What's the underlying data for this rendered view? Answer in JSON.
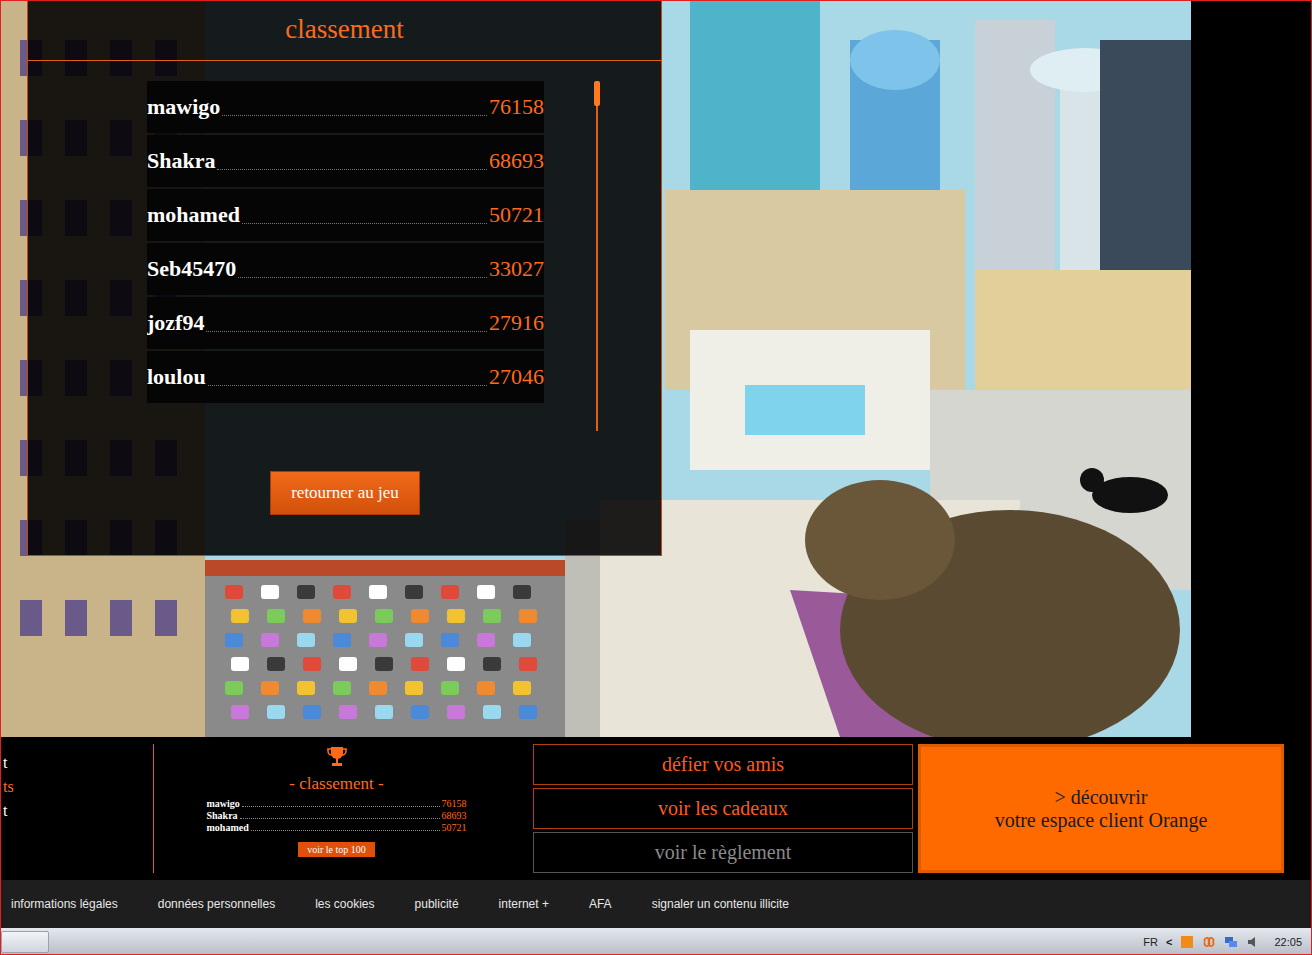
{
  "panel": {
    "title": "classement",
    "button": "retourner au jeu",
    "scrollbar": {
      "level": 0.07
    }
  },
  "ranking": [
    {
      "name": "mawigo",
      "score": "76158"
    },
    {
      "name": "Shakra",
      "score": "68693"
    },
    {
      "name": "mohamed",
      "score": "50721"
    },
    {
      "name": "Seb45470",
      "score": "33027"
    },
    {
      "name": "jozf94",
      "score": "27916"
    },
    {
      "name": "loulou",
      "score": "27046"
    }
  ],
  "bottom_bar": {
    "left_fragment": [
      {
        "text": "t",
        "highlight": false
      },
      {
        "text": "ts",
        "highlight": true
      },
      {
        "text": "t",
        "highlight": false
      }
    ],
    "mini_ranking": {
      "title": "- classement -",
      "rows": [
        {
          "name": "mawigo",
          "score": "76158"
        },
        {
          "name": "Shakra",
          "score": "68693"
        },
        {
          "name": "mohamed",
          "score": "50721"
        }
      ],
      "button": "voir le top 100"
    },
    "buttons": [
      {
        "label": "défier vos amis",
        "greyed": false
      },
      {
        "label": "voir les cadeaux",
        "greyed": false
      },
      {
        "label": "voir le règlement",
        "greyed": true
      }
    ],
    "orange_button": [
      "> découvrir",
      "votre espace client Orange"
    ]
  },
  "footer": {
    "links": [
      "informations légales",
      "données personnelles",
      "les cookies",
      "publicité",
      "internet +",
      "AFA",
      "signaler un contenu illicite"
    ]
  },
  "taskbar": {
    "lang": "FR",
    "expand": "<",
    "time": "22:05"
  }
}
